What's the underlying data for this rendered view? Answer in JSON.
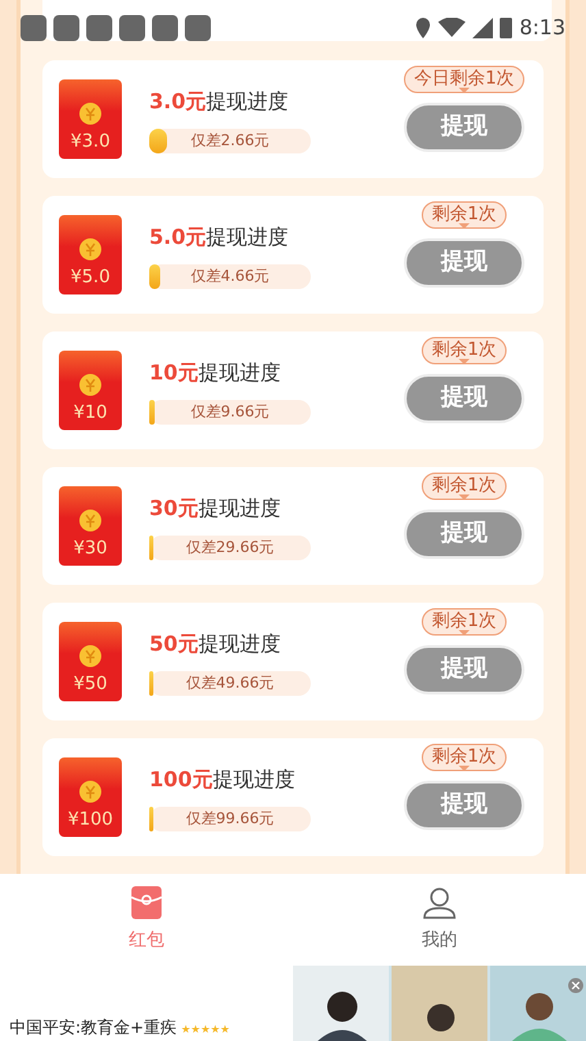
{
  "status_bar": {
    "time": "8:13"
  },
  "withdraw_items": [
    {
      "amount": "3.0元",
      "title": "提现进度",
      "envelope_value": "¥3.0",
      "progress_text": "仅差2.66元",
      "level": 0.11,
      "remaining": "今日剩余1次",
      "button": "提现",
      "disabled": true
    },
    {
      "amount": "5.0元",
      "title": "提现进度",
      "envelope_value": "¥5.0",
      "progress_text": "仅差4.66元",
      "level": 0.07,
      "remaining": "剩余1次",
      "button": "提现",
      "disabled": true
    },
    {
      "amount": "10元",
      "title": "提现进度",
      "envelope_value": "¥10",
      "progress_text": "仅差9.66元",
      "level": 0.03,
      "remaining": "剩余1次",
      "button": "提现",
      "disabled": true
    },
    {
      "amount": "30元",
      "title": "提现进度",
      "envelope_value": "¥30",
      "progress_text": "仅差29.66元",
      "level": 0.012,
      "remaining": "剩余1次",
      "button": "提现",
      "disabled": true
    },
    {
      "amount": "50元",
      "title": "提现进度",
      "envelope_value": "¥50",
      "progress_text": "仅差49.66元",
      "level": 0.007,
      "remaining": "剩余1次",
      "button": "提现",
      "disabled": true
    },
    {
      "amount": "100元",
      "title": "提现进度",
      "envelope_value": "¥100",
      "progress_text": "仅差99.66元",
      "level": 0.003,
      "remaining": "剩余1次",
      "button": "提现",
      "disabled": true
    }
  ],
  "tabs": [
    {
      "label": "红包",
      "kind": "envelope",
      "selected": true
    },
    {
      "label": "我的",
      "kind": "person",
      "selected": false
    }
  ],
  "ad": {
    "text": "中国平安:教育金+重疾",
    "stars": 5,
    "kind": "picture"
  }
}
